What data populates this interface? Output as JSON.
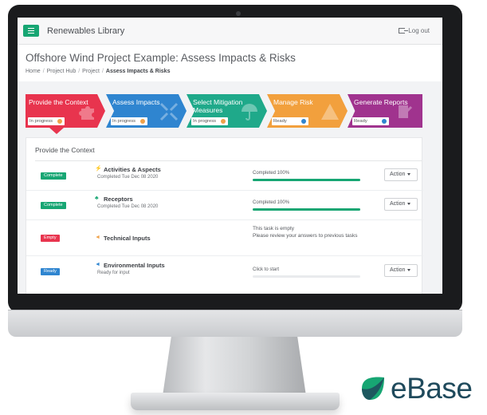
{
  "app": {
    "title": "Renewables Library",
    "logout_label": "Log out"
  },
  "page": {
    "title": "Offshore Wind Project Example: Assess Impacts & Risks",
    "breadcrumb": [
      "Home",
      "Project Hub",
      "Project",
      "Assess Impacts & Risks"
    ],
    "breadcrumb_sep": "/"
  },
  "steps": [
    {
      "name": "Provide the Context",
      "status": "In progress",
      "color": "#e8344e",
      "dot_color": "#f0a24a",
      "icon": "puzzle-icon",
      "active": true
    },
    {
      "name": "Assess Impacts",
      "status": "In progress",
      "color": "#2f85d0",
      "dot_color": "#f0a24a",
      "icon": "arrows-icon",
      "active": false
    },
    {
      "name": "Select Mitigation Measures",
      "status": "In progress",
      "color": "#1fa98a",
      "dot_color": "#f0a24a",
      "icon": "umbrella-icon",
      "active": false
    },
    {
      "name": "Manage Risk",
      "status": "Ready",
      "color": "#f2a03d",
      "dot_color": "#2f85d0",
      "icon": "warning-icon",
      "active": false
    },
    {
      "name": "Generate Reports",
      "status": "Ready",
      "color": "#a0338e",
      "dot_color": "#2f85d0",
      "icon": "report-icon",
      "active": false
    }
  ],
  "section": {
    "title": "Provide the Context"
  },
  "tasks": [
    {
      "badge": "Complete",
      "badge_color": "#17a673",
      "icon": "lightning-icon",
      "icon_glyph": "⚡",
      "icon_color": "#f0a24a",
      "name": "Activities & Aspects",
      "sub": "Completed Tue Dec 08 2020",
      "progress_label": "Completed 100%",
      "progress": 1.0,
      "action": "Action"
    },
    {
      "badge": "Complete",
      "badge_color": "#17a673",
      "icon": "tree-icon",
      "icon_glyph": "♣",
      "icon_color": "#17a673",
      "name": "Receptors",
      "sub": "Completed Tue Dec 08 2020",
      "progress_label": "Completed 100%",
      "progress": 1.0,
      "action": "Action"
    },
    {
      "badge": "Empty",
      "badge_color": "#e8344e",
      "icon": "megaphone-icon",
      "icon_glyph": "◄",
      "icon_color": "#f0a24a",
      "name": "Technical Inputs",
      "sub": "",
      "message": "This task is empty\nPlease review your answers to previous tasks"
    },
    {
      "badge": "Ready",
      "badge_color": "#2f85d0",
      "icon": "megaphone-icon",
      "icon_glyph": "◄",
      "icon_color": "#2f85d0",
      "name": "Environmental Inputs",
      "sub": "Ready for input",
      "progress_label": "Click to start",
      "progress": 0.0,
      "action": "Action"
    }
  ],
  "brand": {
    "name": "eBase",
    "mark_color": "#17a673",
    "text_color": "#1f4a5c"
  }
}
